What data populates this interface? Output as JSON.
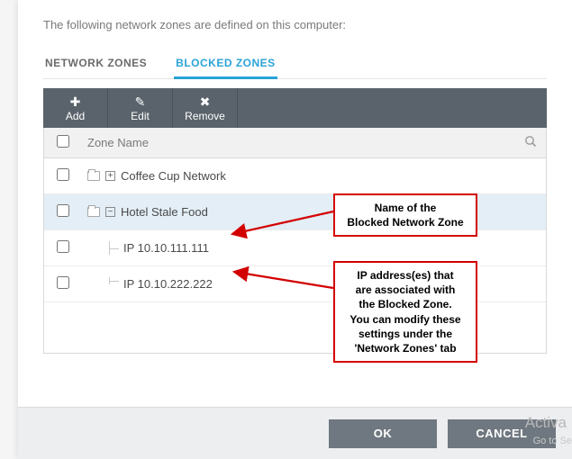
{
  "intro": "The following network zones are defined on this computer:",
  "tabs": {
    "network": "NETWORK ZONES",
    "blocked": "BLOCKED ZONES"
  },
  "toolbar": {
    "add": "Add",
    "edit": "Edit",
    "remove": "Remove"
  },
  "table": {
    "header": "Zone Name",
    "rows": [
      {
        "label": "Coffee Cup Network",
        "type": "zone",
        "expander": "+",
        "selected": false
      },
      {
        "label": "Hotel Stale Food",
        "type": "zone",
        "expander": "−",
        "selected": true
      },
      {
        "label": "IP 10.10.111.111",
        "type": "ip",
        "selected": false
      },
      {
        "label": "IP 10.10.222.222",
        "type": "ip",
        "selected": false
      }
    ]
  },
  "buttons": {
    "ok": "OK",
    "cancel": "CANCEL"
  },
  "callouts": {
    "zone": "Name of the\nBlocked Network Zone",
    "ip": "IP address(es) that\nare associated with\nthe Blocked Zone.\nYou can modify these\nsettings under the\n'Network Zones' tab"
  },
  "watermark": {
    "main": "Activa",
    "sub": "Go to Se"
  }
}
